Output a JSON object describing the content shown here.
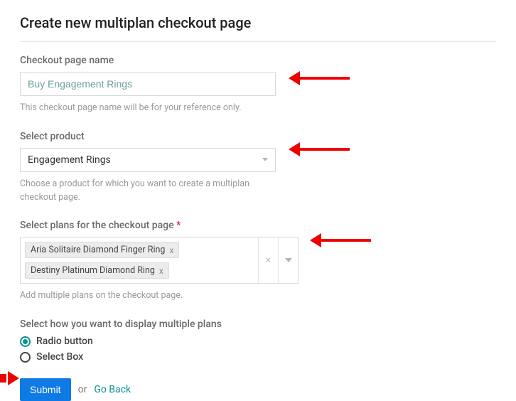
{
  "page_title": "Create new multiplan checkout page",
  "fields": {
    "name": {
      "label": "Checkout page name",
      "value": "Buy Engagement Rings",
      "helper": "This checkout page name will be for your reference only."
    },
    "product": {
      "label": "Select product",
      "value": "Engagement Rings",
      "helper": "Choose a product for which you want to create a multiplan checkout page."
    },
    "plans": {
      "label": "Select plans for the checkout page",
      "required_mark": "*",
      "selected": [
        "Aria Solitaire Diamond Finger Ring",
        "Destiny Platinum Diamond Ring"
      ],
      "helper": "Add multiple plans on the checkout page."
    },
    "display": {
      "label": "Select how you want to display multiple plans",
      "options": [
        {
          "label": "Radio button",
          "selected": true
        },
        {
          "label": "Select Box",
          "selected": false
        }
      ]
    }
  },
  "actions": {
    "submit": "Submit",
    "or": "or",
    "go_back": "Go Back"
  },
  "glyphs": {
    "x": "x",
    "times": "×"
  }
}
